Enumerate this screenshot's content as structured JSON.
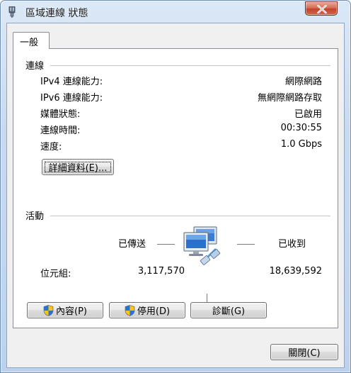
{
  "window": {
    "title": "區域連線 狀態",
    "title_icon": "network-adapter-icon",
    "close_icon": "close-icon"
  },
  "tabs": [
    {
      "label": "一般",
      "selected": true
    }
  ],
  "connection": {
    "section_title": "連線",
    "rows": [
      {
        "label": "IPv4 連線能力:",
        "value": "網際網路"
      },
      {
        "label": "IPv6 連線能力:",
        "value": "無網際網路存取"
      },
      {
        "label": "媒體狀態:",
        "value": "已啟用"
      },
      {
        "label": "連線時間:",
        "value": "00:30:55"
      },
      {
        "label": "速度:",
        "value": "1.0 Gbps"
      }
    ],
    "details_button": "詳細資料(E)..."
  },
  "activity": {
    "section_title": "活動",
    "sent_label": "已傳送",
    "received_label": "已收到",
    "bytes_label": "位元組:",
    "bytes_sent": "3,117,570",
    "bytes_received": "18,639,592",
    "icon": "network-computers-icon"
  },
  "buttons": {
    "properties": "內容(P)",
    "disable": "停用(D)",
    "diagnose": "診斷(G)",
    "close": "關閉(C)"
  },
  "colors": {
    "close_button": "#c7452c",
    "window_frame": "#bcd2ec",
    "dialog_bg": "#f0f0f0"
  }
}
